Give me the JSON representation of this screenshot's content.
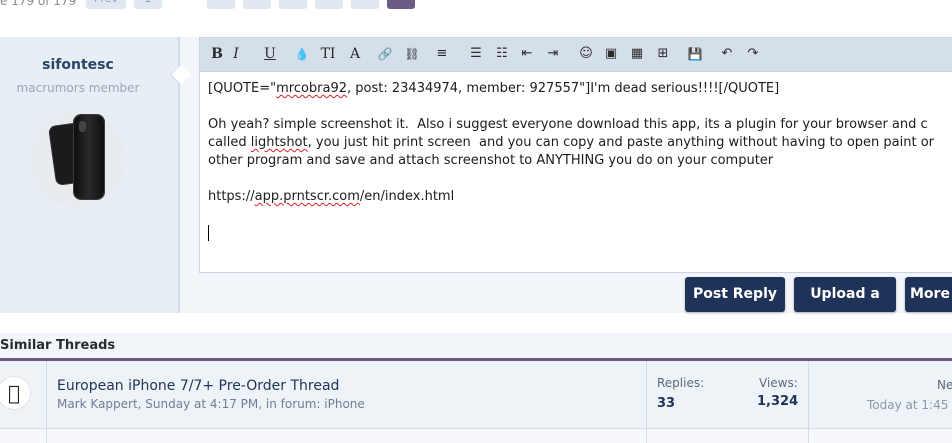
{
  "pagination": {
    "count_text": "e 179 of 179",
    "pages": [
      "Prev",
      "1",
      "",
      "",
      "",
      "",
      "",
      ""
    ],
    "current_page": ""
  },
  "user": {
    "name": "sifontesc",
    "title": "macrumors member"
  },
  "toolbar": {
    "icons": [
      "bold-icon",
      "italic-icon",
      "underline-icon",
      "text-color-icon",
      "font-size-icon",
      "font-icon",
      "link-icon",
      "unlink-icon",
      "align-icon",
      "bullet-list-icon",
      "numbered-list-icon",
      "outdent-icon",
      "indent-icon",
      "smilie-icon",
      "image-icon",
      "media-icon",
      "insert-icon",
      "save-draft-icon",
      "undo-icon",
      "redo-icon"
    ],
    "bold": "B",
    "italic": "I",
    "underline": "U",
    "text_color": "💧",
    "font_size": "TI",
    "font": "A",
    "link": "🔗",
    "unlink": "⛓",
    "align": "≡",
    "bullets": "☰",
    "numbered": "☷",
    "outdent": "⇤",
    "indent": "⇥",
    "smilie": "☺",
    "image": "▣",
    "media": "▦",
    "insert": "⊞",
    "save": "💾",
    "undo": "↶",
    "redo": "↷"
  },
  "editor": {
    "line1_a": "[QUOTE=\"",
    "line1_b": "mrcobra92",
    "line1_c": ", post: 23434974, member: 927557\"]I'm dead serious!!!![/QUOTE]",
    "line2": "Oh yeah? simple screenshot it.  Also i suggest everyone download this app, its a plugin for your browser and c",
    "line3_a": "called ",
    "line3_b": "lightshot",
    "line3_c": ", you just hit print screen  and you can copy and paste anything without having to open paint or",
    "line4": "other program and save and attach screenshot to ANYTHING you do on your computer",
    "url_a": "https://",
    "url_b": "app.prntscr.com",
    "url_c": "/en/index.html"
  },
  "buttons": {
    "post_reply": "Post Reply",
    "upload": "Upload a File",
    "more": "More O"
  },
  "similar": {
    "heading": "Similar Threads",
    "threads": [
      {
        "title": "European iPhone 7/7+ Pre-Order Thread",
        "author": "Mark Kappert",
        "meta": ", Sunday at 4:17 PM, in forum: iPhone",
        "replies_label": "Replies:",
        "replies": "33",
        "views_label": "Views:",
        "views": "1,324",
        "last_user": "Ne",
        "last_time": "Today at 1:45"
      }
    ]
  }
}
